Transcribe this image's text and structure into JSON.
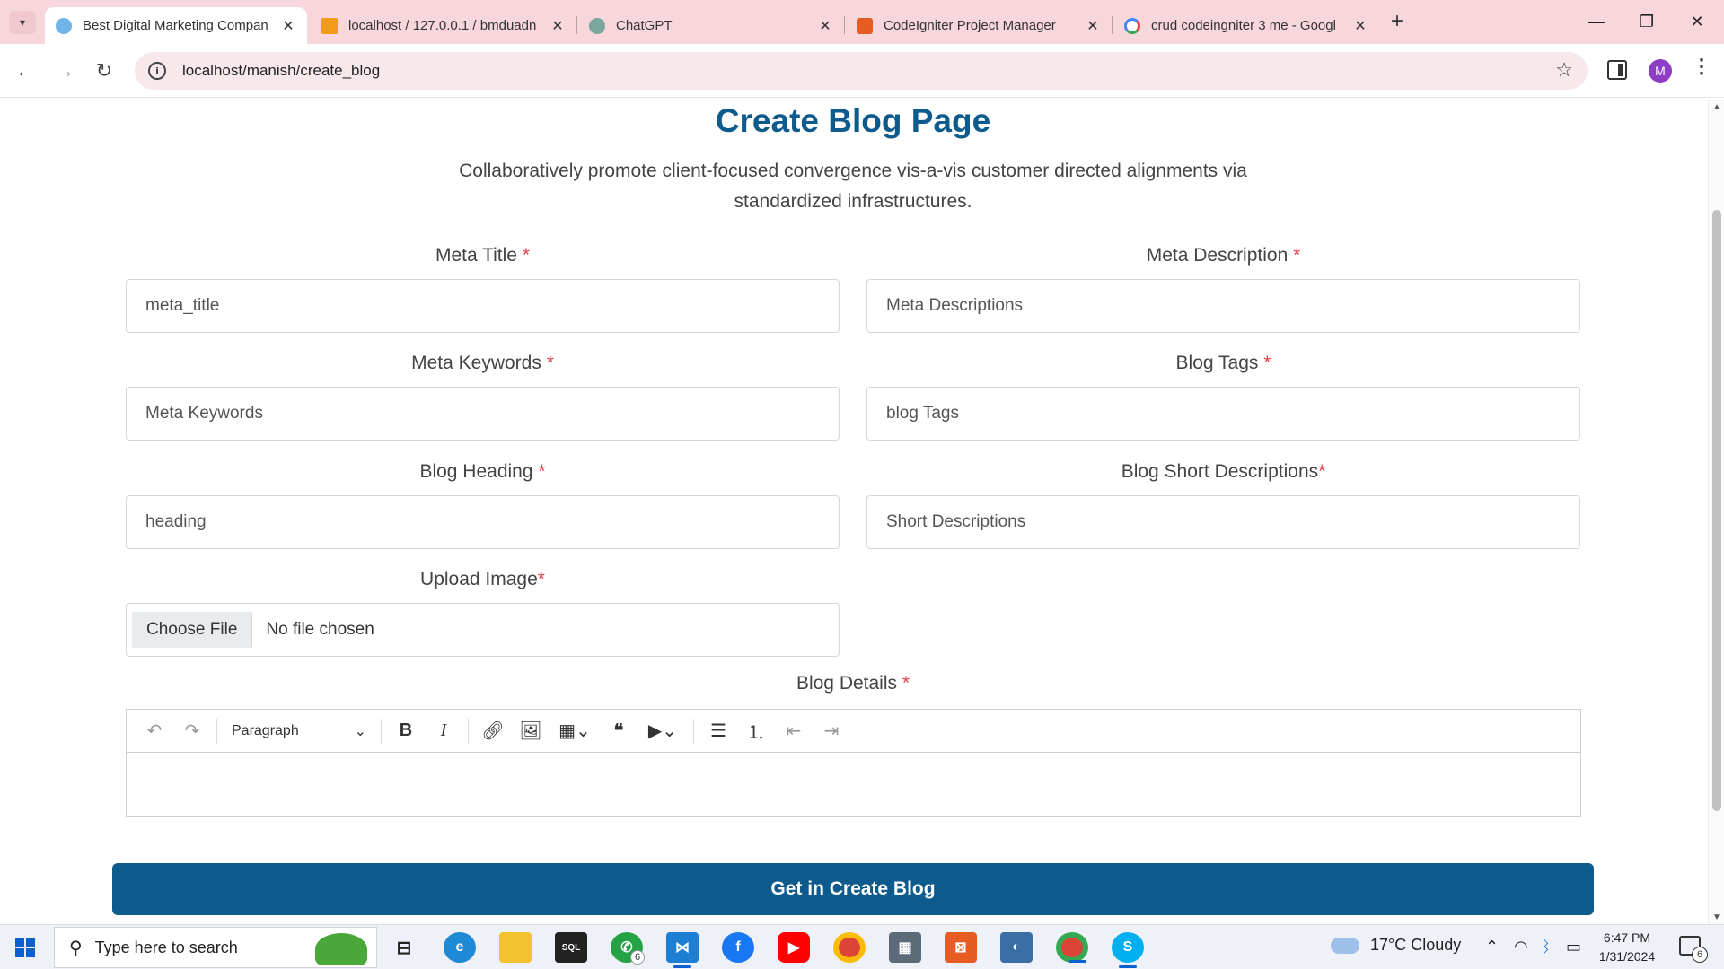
{
  "browser": {
    "tabs": [
      {
        "title": "Best Digital Marketing Compan",
        "favicon": "globe-icon",
        "active": true
      },
      {
        "title": "localhost / 127.0.0.1 / bmduadn",
        "favicon": "phpmyadmin-icon",
        "active": false
      },
      {
        "title": "ChatGPT",
        "favicon": "chatgpt-icon",
        "active": false
      },
      {
        "title": "CodeIgniter Project Manager",
        "favicon": "codeigniter-icon",
        "active": false
      },
      {
        "title": "crud codeingniter 3 me - Googl",
        "favicon": "google-icon",
        "active": false
      }
    ],
    "url": "localhost/manish/create_blog",
    "profile_initial": "M"
  },
  "page": {
    "title": "Create Blog Page",
    "subtitle": "Collaboratively promote client-focused convergence vis-a-vis customer directed alignments via standardized infrastructures.",
    "fields": {
      "meta_title": {
        "label": "Meta Title",
        "required": "*",
        "placeholder": "meta_title"
      },
      "meta_description": {
        "label": "Meta Description",
        "required": "*",
        "placeholder": "Meta Descriptions"
      },
      "meta_keywords": {
        "label": "Meta Keywords",
        "required": "*",
        "placeholder": "Meta Keywords"
      },
      "blog_tags": {
        "label": "Blog Tags",
        "required": "*",
        "placeholder": "blog Tags"
      },
      "blog_heading": {
        "label": "Blog Heading",
        "required": "*",
        "placeholder": "heading"
      },
      "blog_short": {
        "label": "Blog Short Descriptions",
        "required": "*",
        "placeholder": "Short Descriptions"
      },
      "upload_image": {
        "label": "Upload Image",
        "required": "*",
        "button": "Choose File",
        "status": "No file chosen"
      }
    },
    "details": {
      "label": "Blog Details",
      "required": "*",
      "heading_select": "Paragraph"
    },
    "submit_label": "Get in Create Blog"
  },
  "taskbar": {
    "search_placeholder": "Type here to search",
    "whatsapp_badge": "6",
    "weather": "17°C  Cloudy",
    "time": "6:47 PM",
    "date": "1/31/2024",
    "notification_count": "6"
  },
  "colors": {
    "accent": "#0d5a8c",
    "required": "#e3404a",
    "tabstrip": "#f8d7dc"
  }
}
